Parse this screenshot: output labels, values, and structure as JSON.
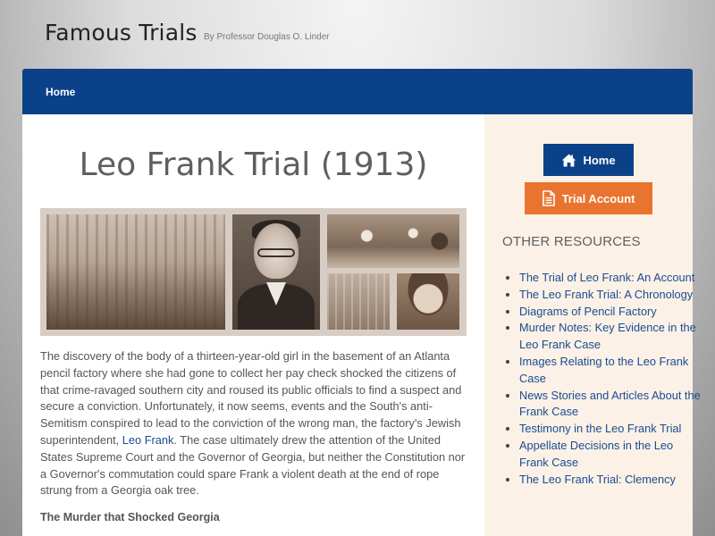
{
  "header": {
    "site_title": "Famous Trials",
    "tagline": "By Professor Douglas O. Linder"
  },
  "nav": {
    "items": [
      {
        "label": "Home"
      }
    ]
  },
  "main": {
    "title": "Leo Frank Trial (1913)",
    "intro": {
      "before_link": "The discovery of the body of a thirteen-year-old girl in the basement of an Atlanta pencil factory where she had gone to collect her pay check shocked the citizens of that crime-ravaged southern city and roused its public officials to find a suspect and secure a conviction. Unfortunately, it now seems, events and the South's anti-Semitism conspired to lead to the conviction of the wrong man, the factory's Jewish superintendent,",
      "link_text": "Leo Frank",
      "after_link": ". The case ultimately drew the attention of the United States Supreme Court and the Governor of Georgia, but neither the Constitution nor a Governor's commutation could spare Frank a violent death at the end of rope strung from a Georgia oak tree."
    },
    "subheading": "The Murder that Shocked Georgia"
  },
  "sidebar": {
    "home_button": "Home",
    "trial_button": "Trial Account",
    "heading": "OTHER RESOURCES",
    "resources": [
      {
        "label": "The Trial of Leo Frank: An Account"
      },
      {
        "label": "The Leo Frank Trial: A Chronology"
      },
      {
        "label": "Diagrams of Pencil Factory"
      },
      {
        "label": "Murder Notes: Key Evidence in the Leo Frank Case"
      },
      {
        "label": "Images Relating to the Leo Frank Case"
      },
      {
        "label": "News Stories and Articles About the Frank Case"
      },
      {
        "label": "Testimony in the Leo Frank Trial"
      },
      {
        "label": "Appellate Decisions in the Leo Frank Case"
      },
      {
        "label": "The Leo Frank Trial: Clemency"
      }
    ]
  },
  "colors": {
    "nav_blue": "#0b4188",
    "accent_orange": "#e9742f",
    "sidebar_bg": "#fbf1e6",
    "link_blue": "#1a4c92"
  },
  "icons": {
    "home_button_icon": "home-icon",
    "trial_button_icon": "document-icon"
  }
}
